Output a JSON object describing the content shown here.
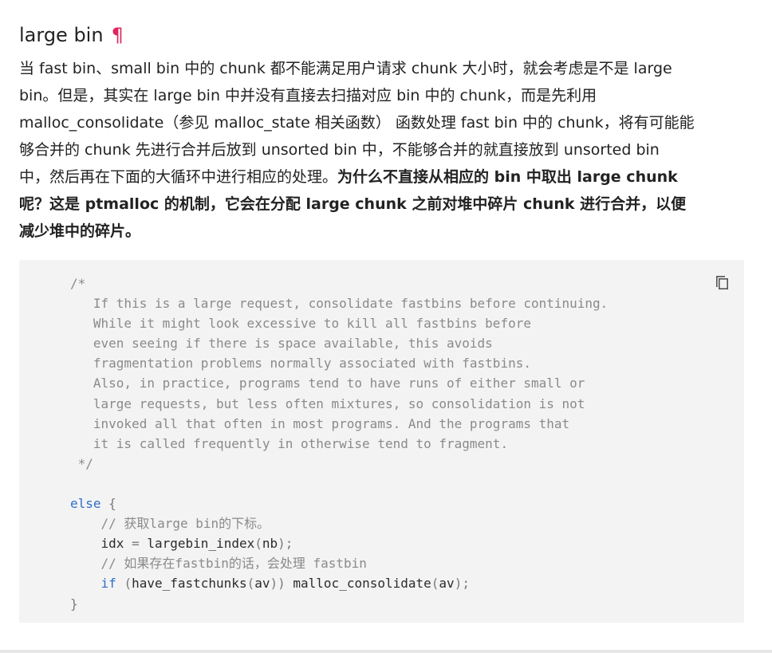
{
  "section": {
    "title": "large bin",
    "anchor_symbol": "¶"
  },
  "paragraph": {
    "line1": "当 fast bin、small bin 中的 chunk 都不能满足用户请求 chunk 大小时，就会考虑是不是 large",
    "line2": "bin。但是，其实在 large bin 中并没有直接去扫描对应 bin 中的 chunk，而是先利用",
    "line3": "malloc_consolidate（参见 malloc_state 相关函数） 函数处理 fast bin 中的 chunk，将有可能能",
    "line4": "够合并的 chunk 先进行合并后放到 unsorted bin 中，不能够合并的就直接放到 unsorted bin",
    "line5_normal": "中，然后再在下面的大循环中进行相应的处理。",
    "line5_bold": "为什么不直接从相应的 bin 中取出 large chunk",
    "line6_bold": "呢？这是 ptmalloc 的机制，它会在分配 large chunk 之前对堆中碎片 chunk 进行合并，以便",
    "line7_bold": "减少堆中的碎片。"
  },
  "code": {
    "comment_open": "/*",
    "comment_lines": [
      "   If this is a large request, consolidate fastbins before continuing.",
      "   While it might look excessive to kill all fastbins before",
      "   even seeing if there is space available, this avoids",
      "   fragmentation problems normally associated with fastbins.",
      "   Also, in practice, programs tend to have runs of either small or",
      "   large requests, but less often mixtures, so consolidation is not",
      "   invoked all that often in most programs. And the programs that",
      "   it is called frequently in otherwise tend to fragment."
    ],
    "comment_close": " */",
    "else_kw": "else",
    "open_brace": "{",
    "cm1": "// 获取large bin的下标。",
    "stmt1_lhs": "idx",
    "stmt1_eq": "=",
    "stmt1_call": "largebin_index",
    "stmt1_lp": "(",
    "stmt1_arg": "nb",
    "stmt1_rp": ");",
    "cm2": "// 如果存在fastbin的话，会处理 fastbin",
    "if_kw": "if",
    "if_lp": "(",
    "if_call": "have_fastchunks",
    "if_arg_lp": "(",
    "if_arg": "av",
    "if_arg_rp": "))",
    "call2": "malloc_consolidate",
    "call2_lp": "(",
    "call2_arg": "av",
    "call2_rp": ");",
    "close_brace": "}"
  },
  "icons": {
    "copy": "copy-icon"
  }
}
